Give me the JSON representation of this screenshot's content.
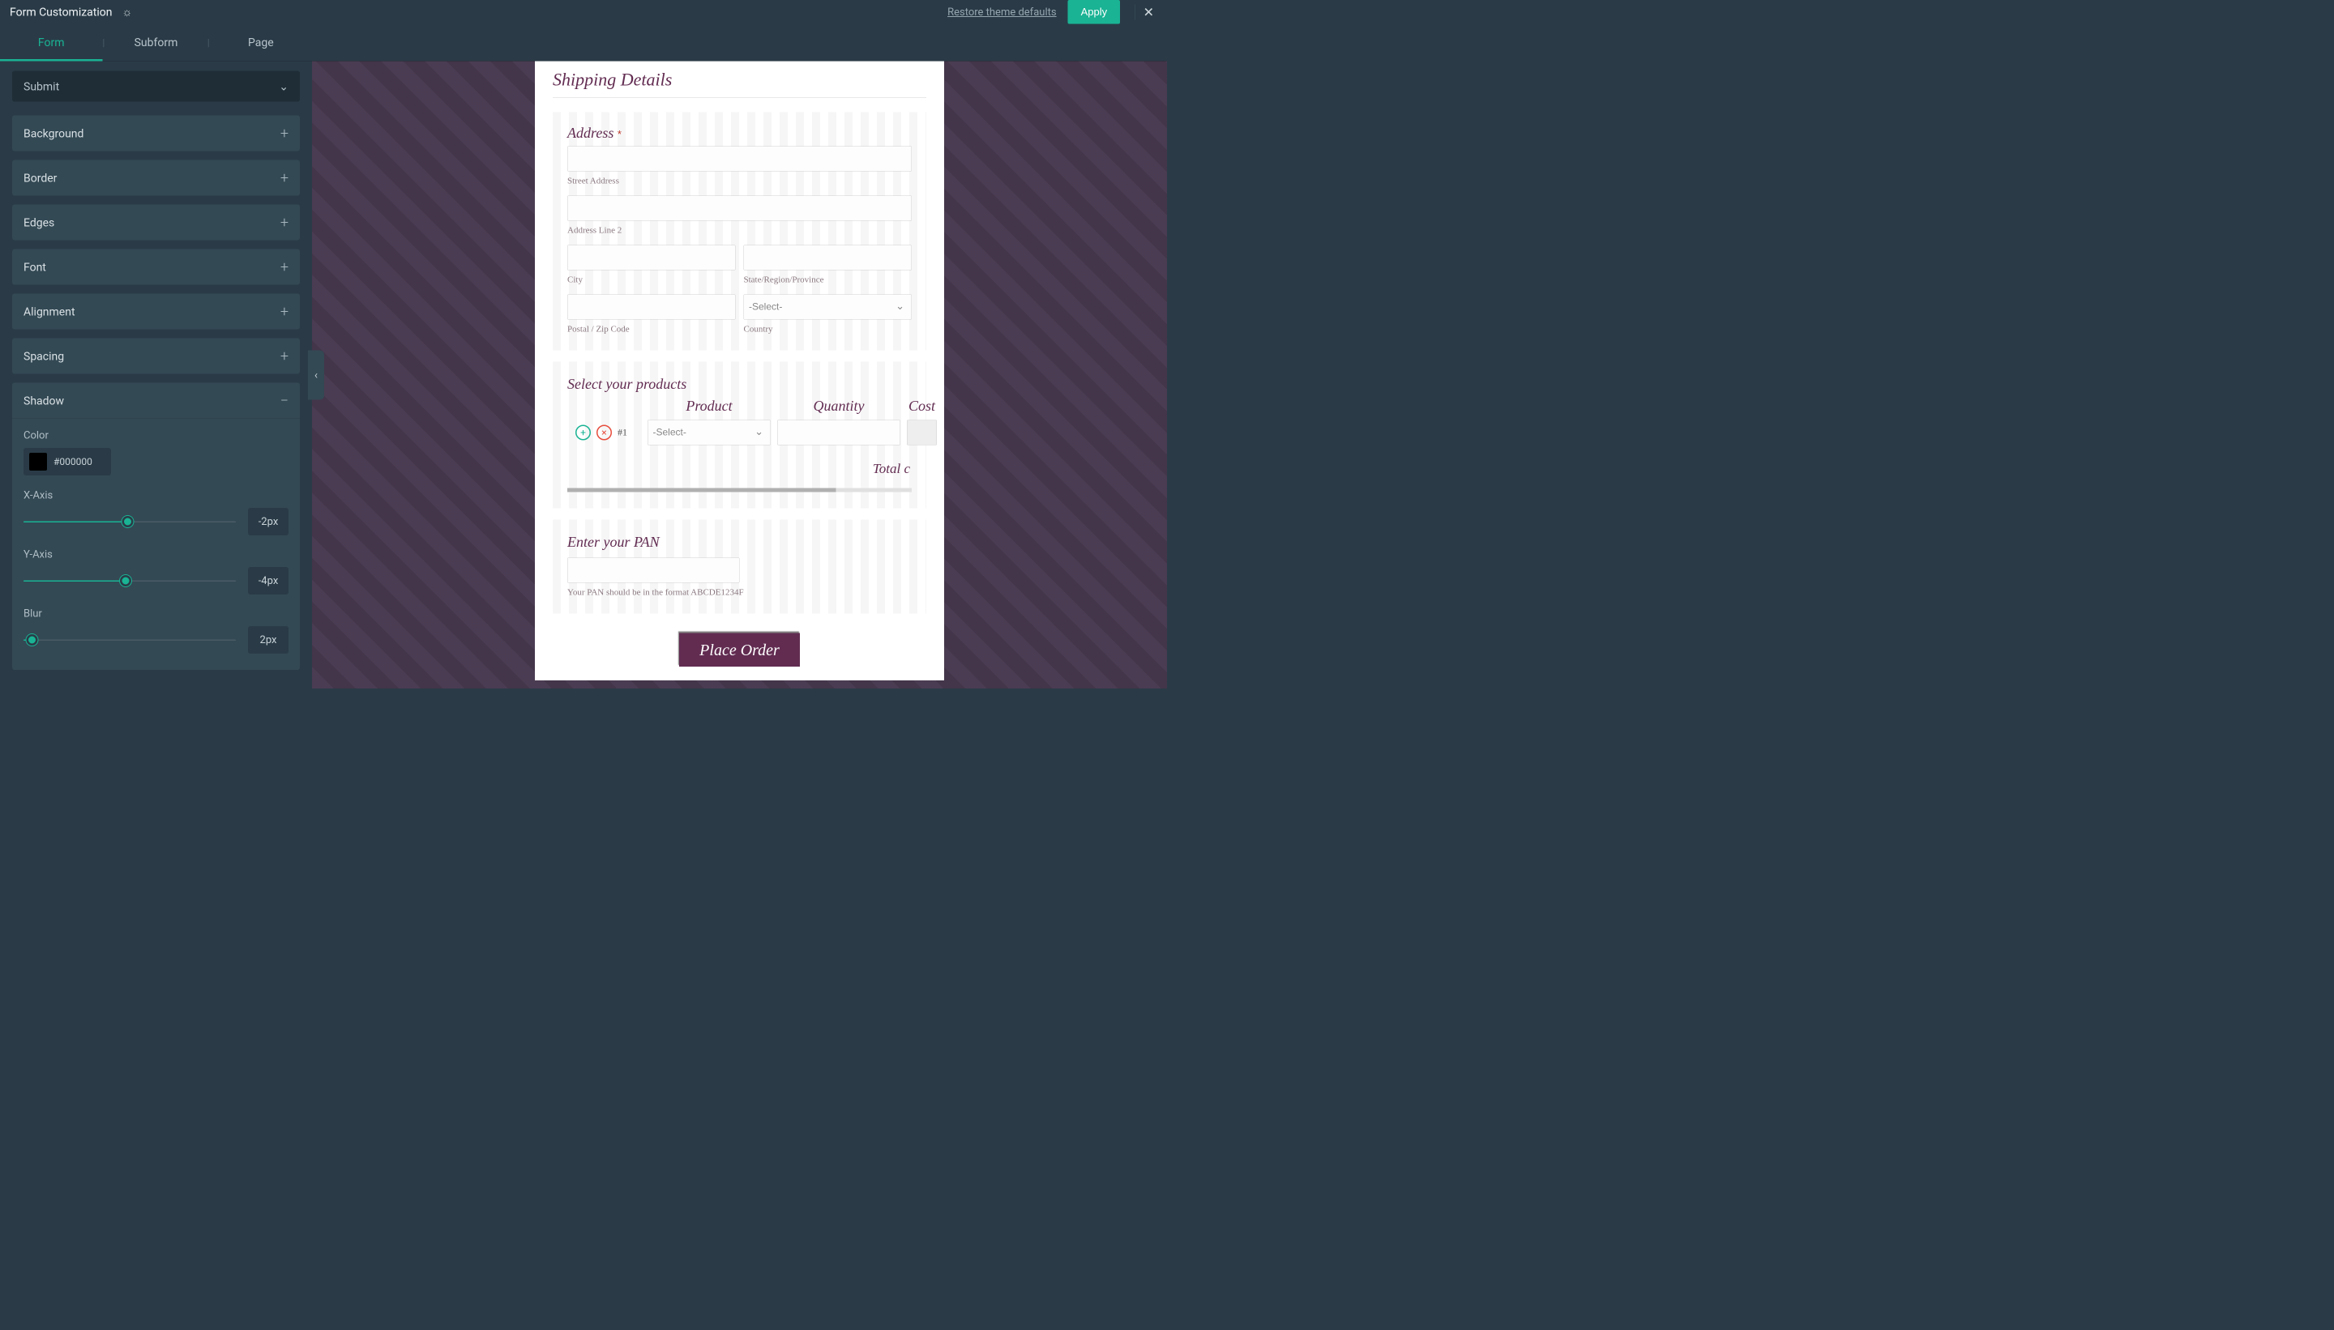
{
  "header": {
    "title": "Form Customization",
    "restore": "Restore theme defaults",
    "apply": "Apply"
  },
  "tabs": [
    "Form",
    "Subform",
    "Page"
  ],
  "activeTab": 0,
  "styleSelector": "Submit",
  "panels": [
    {
      "label": "Background",
      "open": false
    },
    {
      "label": "Border",
      "open": false
    },
    {
      "label": "Edges",
      "open": false
    },
    {
      "label": "Font",
      "open": false
    },
    {
      "label": "Alignment",
      "open": false
    },
    {
      "label": "Spacing",
      "open": false
    },
    {
      "label": "Shadow",
      "open": true
    }
  ],
  "shadow": {
    "colorLabel": "Color",
    "colorHex": "#000000",
    "xLabel": "X-Axis",
    "xValue": "-2px",
    "xPercent": 49,
    "yLabel": "Y-Axis",
    "yValue": "-4px",
    "yPercent": 48,
    "blurLabel": "Blur",
    "blurValue": "2px",
    "blurPercent": 4
  },
  "form": {
    "shippingTitle": "Shipping Details",
    "addressLabel": "Address",
    "streetSub": "Street Address",
    "line2Sub": "Address Line 2",
    "citySub": "City",
    "stateSub": "State/Region/Province",
    "postalSub": "Postal / Zip Code",
    "countrySub": "Country",
    "countryPlaceholder": "-Select-",
    "productsTitle": "Select your products",
    "colProduct": "Product",
    "colQty": "Quantity",
    "colCost": "Cost",
    "rowNum": "#1",
    "productPlaceholder": "-Select-",
    "totalLabel": "Total c",
    "panTitle": "Enter your PAN",
    "panHint": "Your PAN should be in the format ABCDE1234F",
    "submit": "Place Order"
  }
}
